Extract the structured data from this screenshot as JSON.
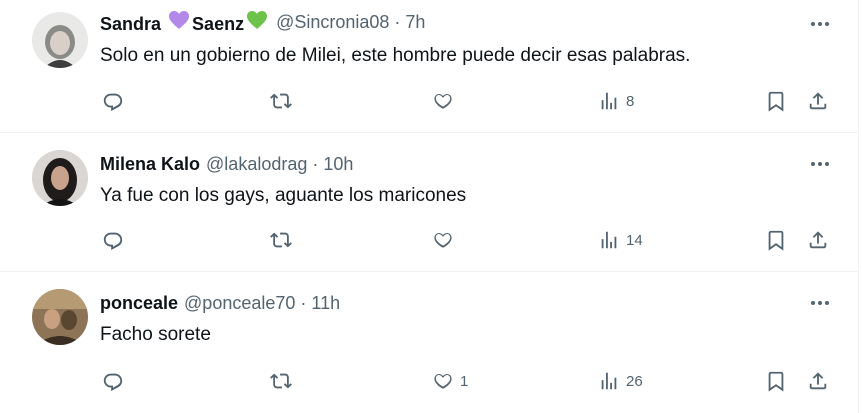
{
  "tweets": [
    {
      "name_part1": "Sandra",
      "name_part2": "Saenz",
      "name_hearts": [
        "#b388e8",
        "#6cc24a"
      ],
      "handle": "@Sincronia08",
      "separator": "·",
      "time": "7h",
      "text": "Solo en un gobierno de Milei, este hombre puede decir esas palabras.",
      "reply_count": "",
      "retweet_count": "",
      "like_count": "",
      "view_count": "8"
    },
    {
      "name": "Milena Kalo",
      "handle": "@lakalodrag",
      "separator": "·",
      "time": "10h",
      "text": "Ya fue con los gays, aguante los maricones",
      "reply_count": "",
      "retweet_count": "",
      "like_count": "",
      "view_count": "14"
    },
    {
      "name": "ponceale",
      "handle": "@ponceale70",
      "separator": "·",
      "time": "11h",
      "text": "Facho sorete",
      "reply_count": "",
      "retweet_count": "",
      "like_count": "1",
      "view_count": "26"
    }
  ],
  "icons": {
    "reply": "reply-icon",
    "retweet": "retweet-icon",
    "like": "heart-icon",
    "views": "views-icon",
    "bookmark": "bookmark-icon",
    "share": "share-icon",
    "more": "more-icon"
  },
  "colors": {
    "text": "#0f1419",
    "secondary": "#536471",
    "divider": "#eff3f4"
  }
}
